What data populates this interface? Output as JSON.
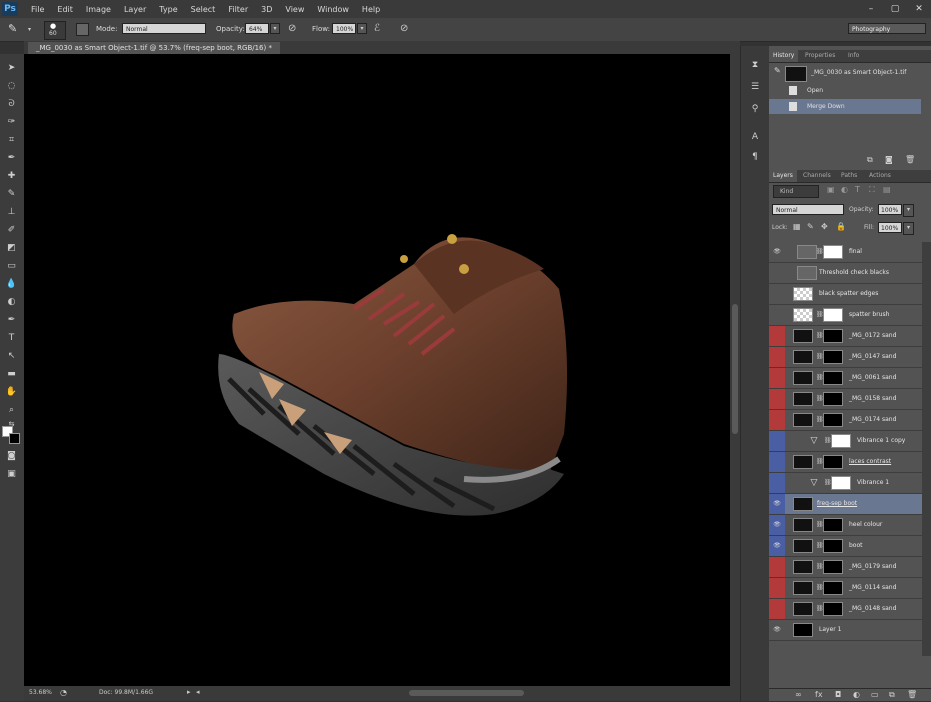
{
  "menubar": {
    "logo": "Ps",
    "items": [
      "File",
      "Edit",
      "Image",
      "Layer",
      "Type",
      "Select",
      "Filter",
      "3D",
      "View",
      "Window",
      "Help"
    ],
    "window_controls": [
      "–",
      "▢",
      "✕"
    ]
  },
  "options": {
    "brush_size": "60",
    "mode_label": "Mode:",
    "mode_value": "Normal",
    "opacity_label": "Opacity:",
    "opacity_value": "64%",
    "flow_label": "Flow:",
    "flow_value": "100%",
    "workspace": "Photography"
  },
  "document": {
    "tab_title": "_MG_0030 as Smart Object-1.tif @ 53.7% (freq-sep boot, RGB/16) *",
    "zoom": "53.68%",
    "doc_info": "Doc: 99.8M/1.66G"
  },
  "history": {
    "tabs": [
      "History",
      "Properties",
      "Info"
    ],
    "snapshot": "_MG_0030 as Smart Object-1.tif",
    "items": [
      {
        "label": "Open",
        "selected": false
      },
      {
        "label": "Merge Down",
        "selected": true
      }
    ]
  },
  "layers": {
    "tabs": [
      "Layers",
      "Channels",
      "Paths",
      "Actions"
    ],
    "kind": "Kind",
    "blend_mode": "Normal",
    "opacity_label": "Opacity:",
    "opacity_value": "100%",
    "lock_label": "Lock:",
    "fill_label": "Fill:",
    "fill_value": "100%",
    "rows": [
      {
        "name": "final",
        "visible": true,
        "label_color": "none",
        "type": "adjust"
      },
      {
        "name": "Threshold check blacks",
        "visible": false,
        "label_color": "none",
        "type": "adjust-nomask"
      },
      {
        "name": "black spatter edges",
        "visible": false,
        "label_color": "none",
        "type": "transparent"
      },
      {
        "name": "spatter brush",
        "visible": false,
        "label_color": "none",
        "type": "transparent-mask"
      },
      {
        "name": "_MG_0172 sand",
        "visible": false,
        "label_color": "red",
        "type": "smart-mask"
      },
      {
        "name": "_MG_0147 sand",
        "visible": false,
        "label_color": "red",
        "type": "smart-mask"
      },
      {
        "name": "_MG_0061 sand",
        "visible": false,
        "label_color": "red",
        "type": "smart-mask"
      },
      {
        "name": "_MG_0158 sand",
        "visible": false,
        "label_color": "red",
        "type": "smart-mask"
      },
      {
        "name": "_MG_0174 sand",
        "visible": false,
        "label_color": "red",
        "type": "smart-mask"
      },
      {
        "name": "Vibrance 1 copy",
        "visible": false,
        "label_color": "blue",
        "type": "vibrance"
      },
      {
        "name": "laces contrast",
        "visible": false,
        "label_color": "blue",
        "type": "smart-mask"
      },
      {
        "name": "Vibrance 1",
        "visible": false,
        "label_color": "blue",
        "type": "vibrance"
      },
      {
        "name": "freq-sep boot",
        "visible": true,
        "label_color": "blue",
        "type": "smart-selected"
      },
      {
        "name": "heel colour",
        "visible": true,
        "label_color": "blue",
        "type": "smart-mask"
      },
      {
        "name": "boot",
        "visible": true,
        "label_color": "blue",
        "type": "smart-mask"
      },
      {
        "name": "_MG_0179 sand",
        "visible": false,
        "label_color": "red",
        "type": "smart-mask"
      },
      {
        "name": "_MG_0114 sand",
        "visible": false,
        "label_color": "red",
        "type": "smart-mask"
      },
      {
        "name": "_MG_0148 sand",
        "visible": false,
        "label_color": "red",
        "type": "smart-mask"
      },
      {
        "name": "Layer 1",
        "visible": true,
        "label_color": "none",
        "type": "black"
      }
    ],
    "footer_icons": [
      "link-icon",
      "fx-icon",
      "mask-icon",
      "adjustment-icon",
      "folder-icon",
      "new-layer-icon",
      "trash-icon"
    ]
  },
  "colors": {
    "red_label": "#b23a3a",
    "blue_label": "#4a5fa3",
    "selected_row": "#6a7790",
    "panel_bg": "#535353"
  }
}
